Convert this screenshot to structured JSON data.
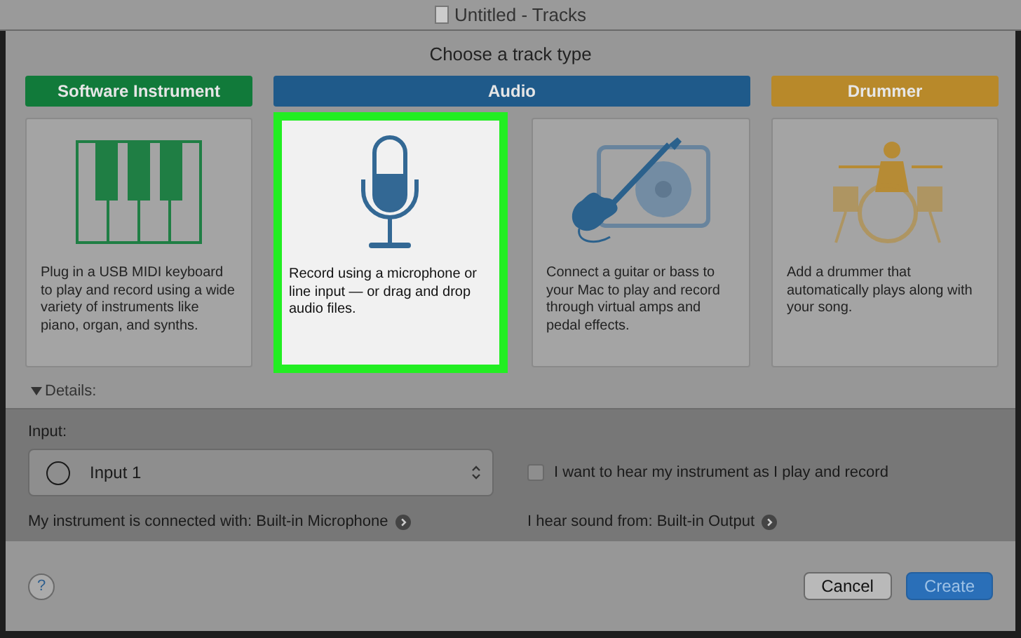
{
  "window": {
    "title": "Untitled - Tracks"
  },
  "dialog": {
    "title": "Choose a track type"
  },
  "categories": [
    {
      "label": "Software Instrument",
      "color": "#117a3a",
      "cards": [
        {
          "kind": "piano",
          "selected": false,
          "description": "Plug in a USB MIDI keyboard to play and record using a wide variety of instruments like piano, organ, and synths."
        }
      ]
    },
    {
      "label": "Audio",
      "color": "#1f5a8a",
      "cards": [
        {
          "kind": "microphone",
          "selected": true,
          "description": "Record using a microphone or line input — or drag and drop audio files."
        },
        {
          "kind": "guitar",
          "selected": false,
          "description": "Connect a guitar or bass to your Mac to play and record through virtual amps and pedal effects."
        }
      ]
    },
    {
      "label": "Drummer",
      "color": "#b8892a",
      "cards": [
        {
          "kind": "drums",
          "selected": false,
          "description": "Add a drummer that automatically plays along with your song."
        }
      ]
    }
  ],
  "details": {
    "label": "Details:",
    "expanded": true,
    "input_label": "Input:",
    "input_value": "Input 1",
    "monitor_checkbox": {
      "label": "I want to hear my instrument as I play and record",
      "checked": false
    },
    "connected_with": "My instrument is connected with: Built-in Microphone",
    "sound_from": "I hear sound from: Built-in Output"
  },
  "buttons": [
    {
      "label": "?",
      "kind": "help"
    },
    {
      "label": "Cancel",
      "kind": "normal"
    },
    {
      "label": "Create",
      "kind": "primary"
    }
  ]
}
